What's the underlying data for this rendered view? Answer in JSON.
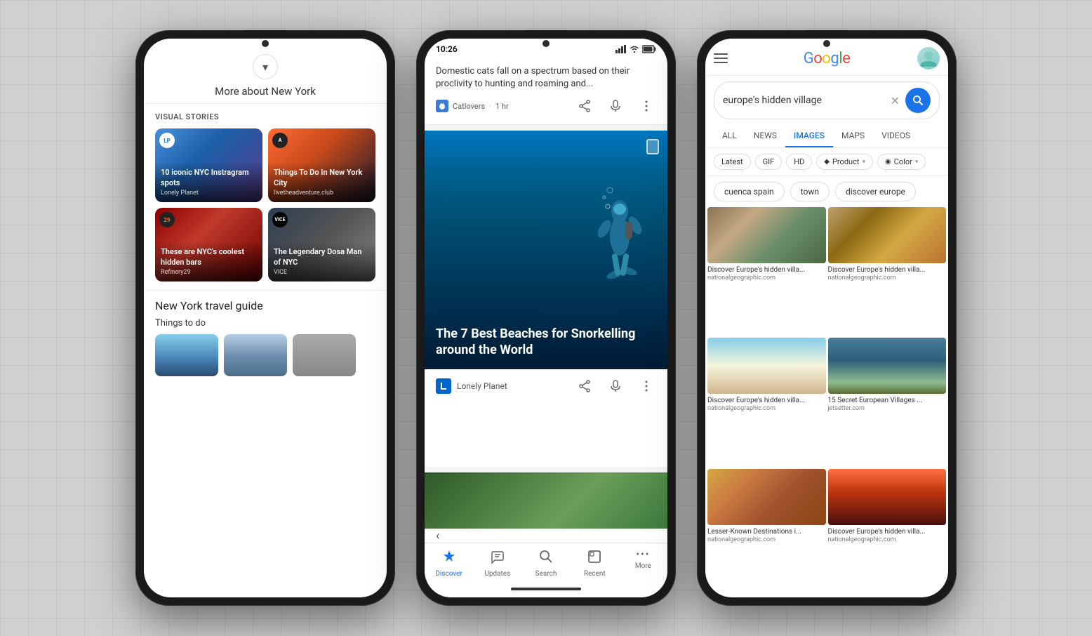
{
  "background": {
    "color": "#d0d0d0"
  },
  "phone1": {
    "header": {
      "chevron_label": "▾",
      "title": "More about New York"
    },
    "visual_stories": {
      "label": "VISUAL STORIES",
      "cards": [
        {
          "title": "10 iconic NYC Instragram spots",
          "source": "Lonely Planet",
          "logo_text": "LP",
          "bg_class": "story-bg-1"
        },
        {
          "title": "Things To Do In New York City",
          "source": "livetheadventure.club",
          "logo_text": "A",
          "bg_class": "story-bg-2"
        },
        {
          "title": "These are NYC's coolest hidden bars",
          "source": "Refinery29",
          "logo_text": "29",
          "bg_class": "story-bg-3"
        },
        {
          "title": "The Legendary Dosa Man of NYC",
          "source": "VICE",
          "logo_text": "V",
          "bg_class": "story-bg-4"
        }
      ]
    },
    "travel_guide": {
      "title": "New York travel guide",
      "things_to_do": "Things to do"
    }
  },
  "phone2": {
    "status_bar": {
      "time": "10:26",
      "icons": "▲ ◆ ■"
    },
    "notification": {
      "text": "Domestic cats fall on a spectrum based on their proclivity to hunting and roaming and...",
      "source": "Catlovers",
      "time": "1 hr"
    },
    "feed_card": {
      "image_title": "The 7 Best Beaches for Snorkelling around the World",
      "source": "Lonely Planet"
    },
    "bottom_nav": {
      "items": [
        {
          "label": "Discover",
          "icon": "✦",
          "active": true
        },
        {
          "label": "Updates",
          "icon": "⇧",
          "active": false
        },
        {
          "label": "Search",
          "icon": "⌕",
          "active": false
        },
        {
          "label": "Recent",
          "icon": "□",
          "active": false
        },
        {
          "label": "More",
          "icon": "•••",
          "active": false
        }
      ]
    }
  },
  "phone3": {
    "search": {
      "query": "europe's hidden village",
      "clear_btn": "✕",
      "search_btn": "🔍"
    },
    "filter_tabs": [
      {
        "label": "ALL",
        "active": false
      },
      {
        "label": "NEWS",
        "active": false
      },
      {
        "label": "IMAGES",
        "active": true
      },
      {
        "label": "MAPS",
        "active": false
      },
      {
        "label": "VIDEOS",
        "active": false
      }
    ],
    "image_filters": [
      {
        "label": "Latest"
      },
      {
        "label": "GIF"
      },
      {
        "label": "HD"
      },
      {
        "label": "Product",
        "has_icon": true,
        "icon": "◆"
      },
      {
        "label": "Color",
        "has_icon": true,
        "icon": "◉"
      }
    ],
    "suggestion_chips": [
      {
        "label": "cuenca spain"
      },
      {
        "label": "town"
      },
      {
        "label": "discover europe"
      }
    ],
    "image_results": [
      {
        "caption": "Discover Europe's hidden villa...",
        "source": "nationalgeographic.com",
        "bg_class": "img-bg-1"
      },
      {
        "caption": "Discover Europe's hidden villa...",
        "source": "nationalgeographic.com",
        "bg_class": "img-bg-2"
      },
      {
        "caption": "Discover Europe's hidden villa...",
        "source": "nationalgeographic.com",
        "bg_class": "img-bg-3"
      },
      {
        "caption": "15 Secret European Villages ...",
        "source": "jetsetter.com",
        "bg_class": "img-bg-4"
      },
      {
        "caption": "Lesser-Known Destinations i...",
        "source": "nationalgeographic.com",
        "bg_class": "img-bg-5"
      },
      {
        "caption": "Discover Europe's hidden villa...",
        "source": "nationalgeographic.com",
        "bg_class": "img-bg-6"
      }
    ],
    "google_logo": {
      "g": "G",
      "o1": "o",
      "o2": "o",
      "g2": "g",
      "l": "l",
      "e": "e"
    }
  }
}
